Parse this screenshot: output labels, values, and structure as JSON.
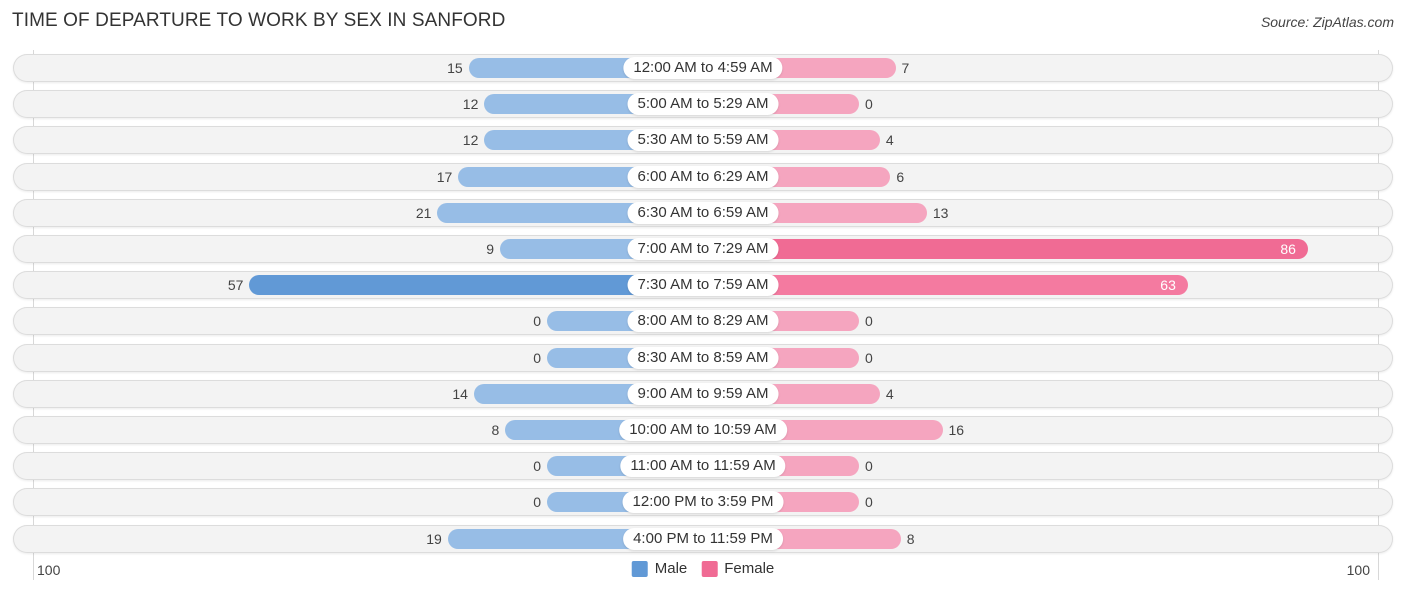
{
  "chart_data": {
    "type": "bar",
    "orientation": "horizontal-diverging",
    "title": "TIME OF DEPARTURE TO WORK BY SEX IN SANFORD",
    "source": "Source: ZipAtlas.com",
    "categories": [
      "12:00 AM to 4:59 AM",
      "5:00 AM to 5:29 AM",
      "5:30 AM to 5:59 AM",
      "6:00 AM to 6:29 AM",
      "6:30 AM to 6:59 AM",
      "7:00 AM to 7:29 AM",
      "7:30 AM to 7:59 AM",
      "8:00 AM to 8:29 AM",
      "8:30 AM to 8:59 AM",
      "9:00 AM to 9:59 AM",
      "10:00 AM to 10:59 AM",
      "11:00 AM to 11:59 AM",
      "12:00 PM to 3:59 PM",
      "4:00 PM to 11:59 PM"
    ],
    "series": [
      {
        "name": "Male",
        "color": "#6199d6",
        "light_color": "#97bde6",
        "values": [
          15,
          12,
          12,
          17,
          21,
          9,
          57,
          0,
          0,
          14,
          8,
          0,
          0,
          19
        ]
      },
      {
        "name": "Female",
        "color": "#f06b94",
        "light_color": "#f5a5bf",
        "values": [
          7,
          0,
          4,
          6,
          13,
          86,
          63,
          0,
          0,
          4,
          16,
          0,
          0,
          8
        ]
      }
    ],
    "axis": {
      "left_label": "100",
      "right_label": "100",
      "range": [
        0,
        100
      ]
    },
    "legend": {
      "position": "bottom-center",
      "entries": [
        "Male",
        "Female"
      ]
    },
    "grid": false
  }
}
